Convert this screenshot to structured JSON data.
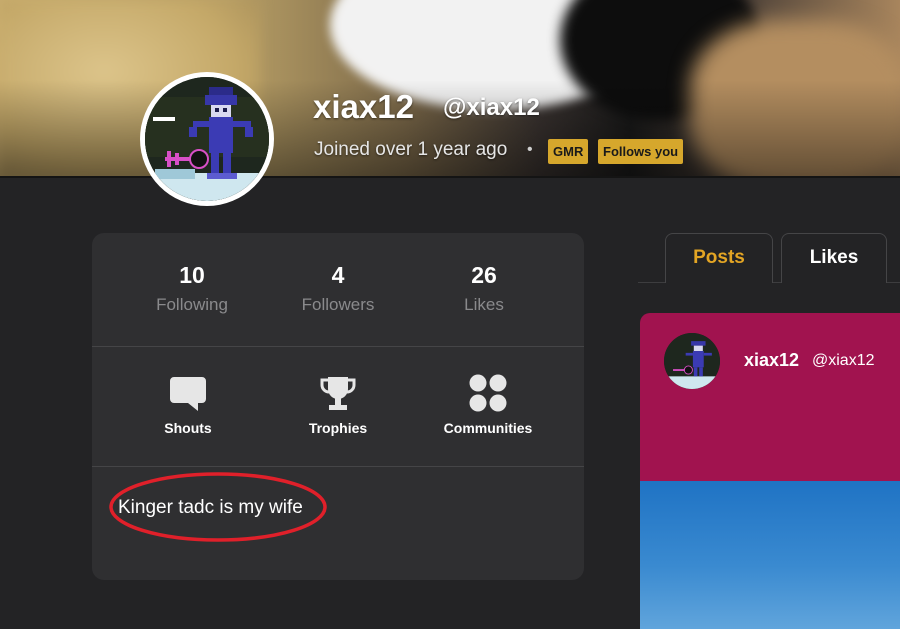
{
  "profile": {
    "display_name": "xiax12",
    "handle": "@xiax12",
    "joined": "Joined over 1 year ago",
    "separator": "•",
    "badges": [
      "GMR",
      "Follows you"
    ],
    "avatar_icon": "pixel-character-avatar"
  },
  "stats": [
    {
      "value": "10",
      "label": "Following"
    },
    {
      "value": "4",
      "label": "Followers"
    },
    {
      "value": "26",
      "label": "Likes"
    }
  ],
  "actions": [
    {
      "label": "Shouts",
      "icon": "speech-bubble-icon"
    },
    {
      "label": "Trophies",
      "icon": "trophy-icon"
    },
    {
      "label": "Communities",
      "icon": "grid-dots-icon"
    }
  ],
  "bio": "Kinger tadc is my wife",
  "tabs": [
    {
      "label": "Posts",
      "active": true
    },
    {
      "label": "Likes",
      "active": false
    }
  ],
  "post": {
    "author_name": "xiax12",
    "author_handle": "@xiax12"
  },
  "colors": {
    "accent": "#e3a524",
    "badge": "#d6a72c",
    "panel": "#2f2f31",
    "background": "#232325",
    "annotation": "#e0202a",
    "post_header": "#a1134f"
  }
}
